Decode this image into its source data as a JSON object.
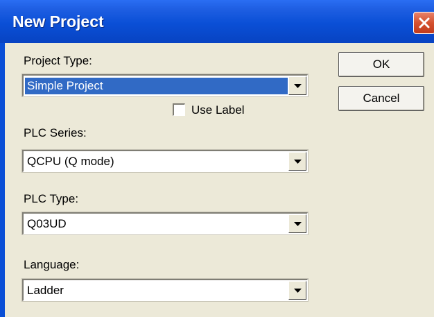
{
  "dialog": {
    "title": "New Project",
    "close_icon": "close-icon"
  },
  "project_type": {
    "label": "Project Type:",
    "value": "Simple Project"
  },
  "use_label": {
    "label": "Use Label",
    "checked": false
  },
  "plc_series": {
    "label": "PLC Series:",
    "value": "QCPU (Q mode)"
  },
  "plc_type": {
    "label": "PLC Type:",
    "value": "Q03UD"
  },
  "language": {
    "label": "Language:",
    "value": "Ladder"
  },
  "buttons": {
    "ok": "OK",
    "cancel": "Cancel"
  },
  "colors": {
    "titlebar": "#0a4fd6",
    "selection": "#316ac5",
    "close": "#d4512f",
    "face": "#ece9d8"
  }
}
